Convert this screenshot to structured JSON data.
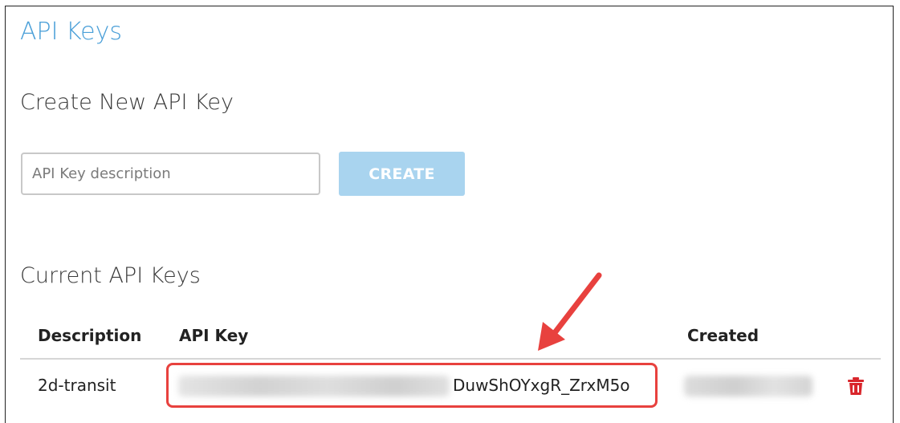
{
  "page": {
    "title": "API Keys"
  },
  "create_section": {
    "title": "Create New API Key",
    "description_placeholder": "API Key description",
    "description_value": "",
    "create_button_label": "CREATE"
  },
  "current_section": {
    "title": "Current API Keys",
    "columns": {
      "description": "Description",
      "api_key": "API Key",
      "created": "Created"
    },
    "rows": [
      {
        "description": "2d-transit",
        "api_key_visible_suffix": "DuwShOYxgR_ZrxM5o",
        "api_key_prefix_redacted": true,
        "created_redacted": true,
        "delete_icon": "trash-icon"
      }
    ]
  },
  "annotation": {
    "highlight_color": "#e8413e",
    "arrow_color": "#e8413e"
  },
  "colors": {
    "title_blue": "#4a9fd8",
    "button_disabled_blue": "#a9d4ef",
    "delete_red": "#d9262c"
  }
}
